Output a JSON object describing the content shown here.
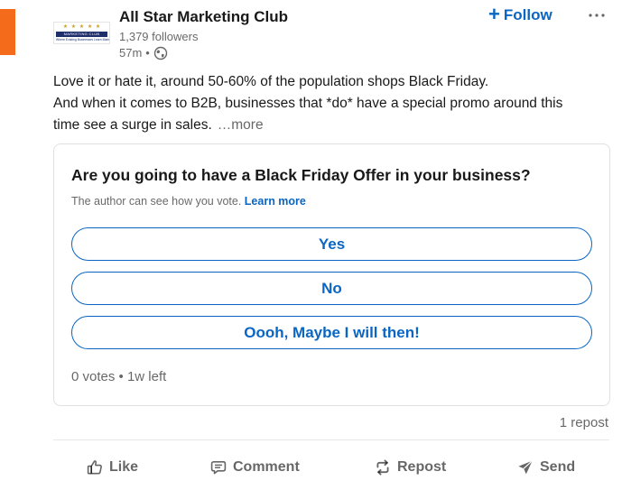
{
  "author": {
    "name": "All Star Marketing Club",
    "followers": "1,379 followers",
    "time": "57m",
    "separator": "•",
    "logo_text": {
      "band": "MARKETING CLUB",
      "tagline": "Where Existing Businesses Learn Marketing",
      "stars": "★ ★ ★ ★ ★"
    },
    "follow_label": "Follow",
    "follow_plus": "+"
  },
  "commentary": {
    "line1": "Love it or hate it, around 50-60% of the population shops Black Friday.",
    "line2": "And when it comes to B2B, businesses that *do* have a special promo around this",
    "line3": "time see a surge in sales.",
    "see_more": "…more"
  },
  "poll": {
    "question": "Are you going to have a Black Friday Offer in your business?",
    "note": "The author can see how you vote.",
    "learn_more": "Learn more",
    "options": [
      {
        "label": "Yes"
      },
      {
        "label": "No"
      },
      {
        "label": "Oooh, Maybe I will then!"
      }
    ],
    "stats": "0 votes • 1w left"
  },
  "social": {
    "reposts": "1 repost"
  },
  "actions": {
    "like": "Like",
    "comment": "Comment",
    "repost": "Repost",
    "send": "Send"
  },
  "colors": {
    "accent_bar": "#f46b1c",
    "link_blue": "#0a66c2",
    "logo_navy": "#1f2f6b",
    "logo_gold": "#c9a227"
  },
  "icons": {
    "visibility": "globe-icon",
    "overflow": "more-horizontal-icon",
    "like": "thumbs-up-icon",
    "comment": "comment-icon",
    "repost": "repost-icon",
    "send": "send-icon"
  }
}
